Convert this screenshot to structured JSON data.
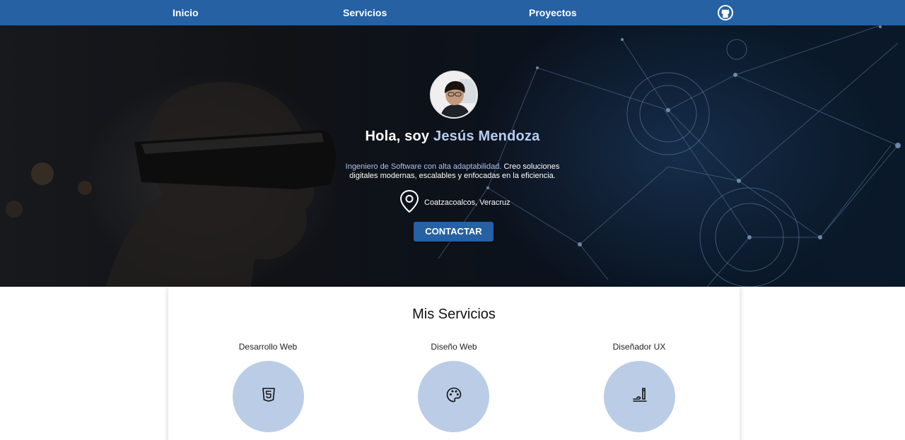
{
  "nav": {
    "items": [
      "Inicio",
      "Servicios",
      "Proyectos"
    ],
    "github_icon": "github-icon"
  },
  "hero": {
    "greeting": "Hola, soy ",
    "name": "Jesús Mendoza",
    "bio_highlight": "Ingeniero de Software con alta adaptabilidad.",
    "bio_rest_line1": " Creo soluciones",
    "bio_line2": "digitales modernas, escalables y enfocadas en la eficiencia.",
    "location_icon": "map-pin-icon",
    "location": "Coatzacoalcos, Veracruz",
    "contact_button": "CONTACTAR",
    "accent_color": "#b8cdf0"
  },
  "services": {
    "title": "Mis Servicios",
    "items": [
      {
        "label": "Desarrollo Web",
        "icon": "html5-icon"
      },
      {
        "label": "Diseño Web",
        "icon": "palette-icon"
      },
      {
        "label": "Diseñador UX",
        "icon": "ux-pen-icon"
      }
    ]
  },
  "colors": {
    "nav_bg": "#2561a3",
    "circle_bg": "#bbcde6"
  }
}
